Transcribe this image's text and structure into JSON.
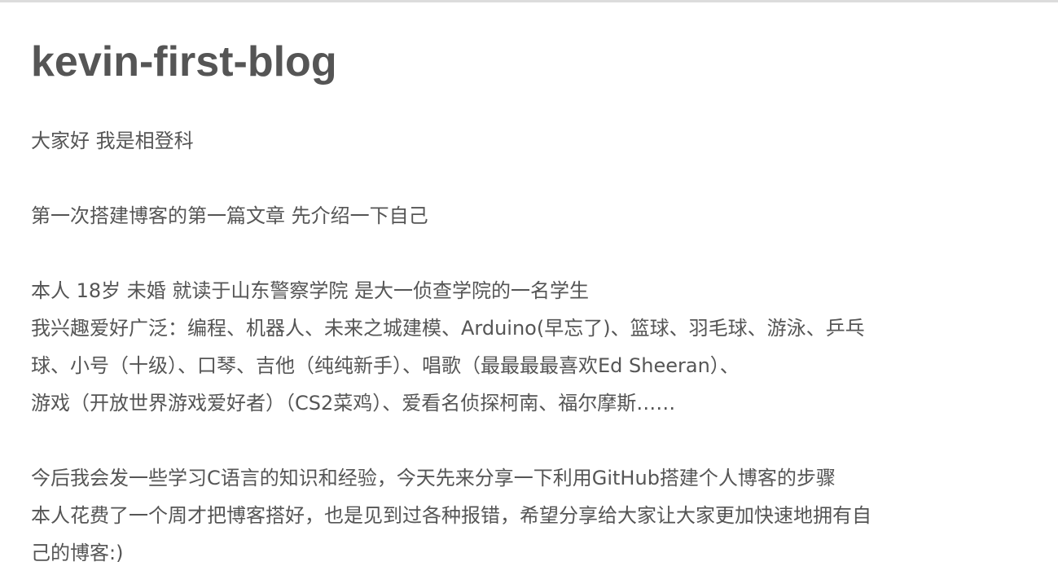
{
  "post": {
    "title": "kevin-first-blog",
    "paragraphs": [
      [
        "大家好 我是相登科"
      ],
      [
        "第一次搭建博客的第一篇文章 先介绍一下自己"
      ],
      [
        "本人 18岁 未婚 就读于山东警察学院 是大一侦查学院的一名学生",
        "我兴趣爱好广泛：编程、机器人、未来之城建模、Arduino(早忘了)、篮球、羽毛球、游泳、乒乓",
        "球、小号（十级）、口琴、吉他（纯纯新手）、唱歌（最最最最喜欢Ed Sheeran）、",
        "游戏（开放世界游戏爱好者）（CS2菜鸡）、爱看名侦探柯南、福尔摩斯……"
      ],
      [
        "今后我会发一些学习C语言的知识和经验，今天先来分享一下利用GitHub搭建个人博客的步骤",
        "本人花费了一个周才把博客搭好，也是见到过各种报错，希望分享给大家让大家更加快速地拥有自",
        "己的博客:)"
      ]
    ]
  }
}
